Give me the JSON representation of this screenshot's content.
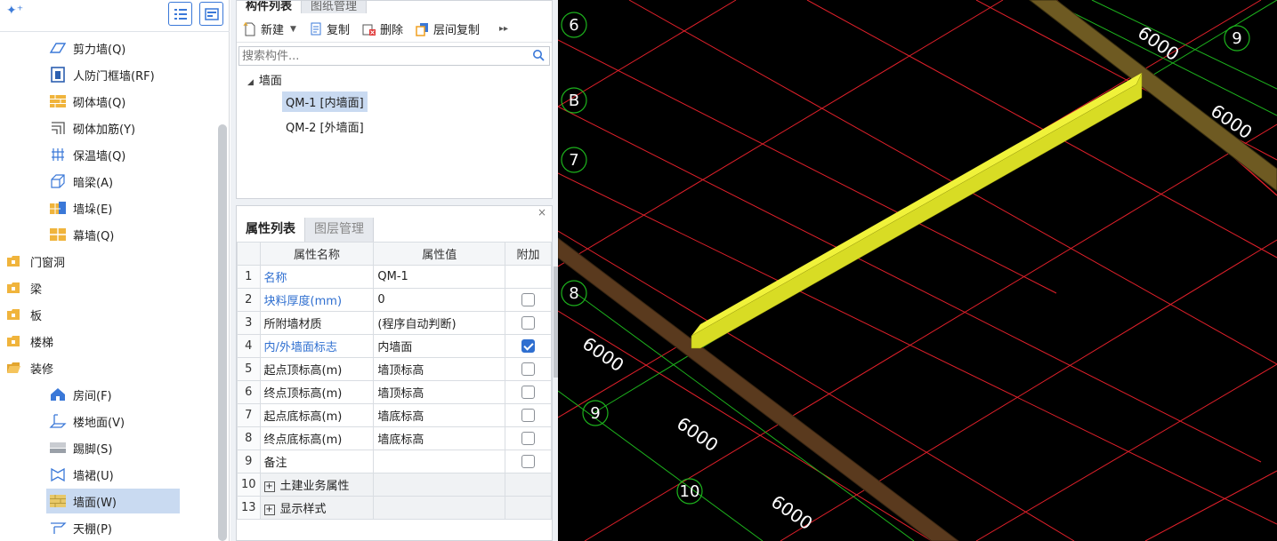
{
  "left_panel": {
    "items": [
      {
        "label": "剪力墙(Q)",
        "icon": "shear-wall-icon"
      },
      {
        "label": "人防门框墙(RF)",
        "icon": "civil-defense-door-frame-wall-icon"
      },
      {
        "label": "砌体墙(Q)",
        "icon": "masonry-wall-icon"
      },
      {
        "label": "砌体加筋(Y)",
        "icon": "masonry-reinforcement-icon"
      },
      {
        "label": "保温墙(Q)",
        "icon": "insulation-wall-icon"
      },
      {
        "label": "暗梁(A)",
        "icon": "hidden-beam-icon"
      },
      {
        "label": "墙垛(E)",
        "icon": "wall-pier-icon"
      },
      {
        "label": "幕墙(Q)",
        "icon": "curtain-wall-icon"
      }
    ],
    "categories": [
      {
        "label": "门窗洞",
        "icon": "folder-icon"
      },
      {
        "label": "梁",
        "icon": "folder-icon"
      },
      {
        "label": "板",
        "icon": "folder-icon"
      },
      {
        "label": "楼梯",
        "icon": "folder-icon"
      },
      {
        "label": "装修",
        "icon": "folder-open-icon"
      }
    ],
    "decoration_items": [
      {
        "label": "房间(F)",
        "icon": "room-icon"
      },
      {
        "label": "楼地面(V)",
        "icon": "floor-surface-icon"
      },
      {
        "label": "踢脚(S)",
        "icon": "skirting-icon"
      },
      {
        "label": "墙裙(U)",
        "icon": "dado-icon"
      },
      {
        "label": "墙面(W)",
        "icon": "wall-surface-icon",
        "selected": true
      },
      {
        "label": "天棚(P)",
        "icon": "ceiling-icon"
      }
    ]
  },
  "component_panel": {
    "tabs": [
      "构件列表",
      "图纸管理"
    ],
    "toolbar": {
      "new_label": "新建",
      "copy_label": "复制",
      "delete_label": "删除",
      "floor_copy_label": "层间复制"
    },
    "search_placeholder": "搜索构件...",
    "tree": {
      "root": "墙面",
      "children": [
        "QM-1 [内墙面]",
        "QM-2 [外墙面]"
      ]
    }
  },
  "property_panel": {
    "tabs": [
      "属性列表",
      "图层管理"
    ],
    "headers": [
      "属性名称",
      "属性值",
      "附加"
    ],
    "rows": [
      {
        "no": "1",
        "name": "名称",
        "value": "QM-1",
        "blue": true,
        "has_check": false,
        "checked": false
      },
      {
        "no": "2",
        "name": "块料厚度(mm)",
        "value": "0",
        "blue": true,
        "has_check": true,
        "checked": false
      },
      {
        "no": "3",
        "name": "所附墙材质",
        "value": "(程序自动判断)",
        "blue": false,
        "has_check": true,
        "checked": false
      },
      {
        "no": "4",
        "name": "内/外墙面标志",
        "value": "内墙面",
        "blue": true,
        "has_check": true,
        "checked": true
      },
      {
        "no": "5",
        "name": "起点顶标高(m)",
        "value": "墙顶标高",
        "blue": false,
        "has_check": true,
        "checked": false
      },
      {
        "no": "6",
        "name": "终点顶标高(m)",
        "value": "墙顶标高",
        "blue": false,
        "has_check": true,
        "checked": false
      },
      {
        "no": "7",
        "name": "起点底标高(m)",
        "value": "墙底标高",
        "blue": false,
        "has_check": true,
        "checked": false
      },
      {
        "no": "8",
        "name": "终点底标高(m)",
        "value": "墙底标高",
        "blue": false,
        "has_check": true,
        "checked": false
      },
      {
        "no": "9",
        "name": "备注",
        "value": "",
        "blue": false,
        "has_check": true,
        "checked": false
      }
    ],
    "groups": [
      {
        "no": "10",
        "name": "土建业务属性"
      },
      {
        "no": "13",
        "name": "显示样式"
      }
    ]
  },
  "viewport": {
    "axis_labels": {
      "a6": "6",
      "b": "B",
      "a7": "7",
      "a8": "8",
      "a9": "9",
      "a10": "10",
      "a9_right": "9"
    },
    "dimension_labels": {
      "d1": "6000",
      "d2": "6000",
      "d3": "6000",
      "d4": "6000",
      "d5": "6000"
    },
    "colors": {
      "background": "#000000",
      "grid_line": "#e0202a",
      "dimension_line": "#1db31d",
      "selected_wall": "#d8dc24",
      "wall": "#5a3a1e"
    }
  }
}
